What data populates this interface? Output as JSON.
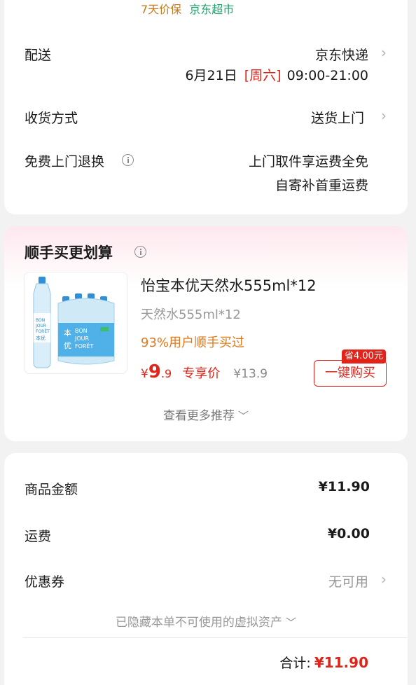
{
  "delivery": {
    "price_protect_label": "7天价保",
    "store_tag": "京东超市",
    "shipping_label": "配送",
    "shipping_carrier": "京东快递",
    "shipping_date": "6月21日",
    "shipping_weekday": "[周六]",
    "shipping_time": "09:00-21:00",
    "receive_method_label": "收货方式",
    "receive_method_value": "送货上门",
    "free_return_label": "免费上门退换",
    "free_return_line1": "上门取件享运费全免",
    "free_return_line2": "自寄补首重运费"
  },
  "addon": {
    "title": "顺手买更划算",
    "product": {
      "name": "怡宝本优天然水555ml*12",
      "spec": "天然水555ml*12",
      "bought_ratio": "93%用户顺手买过",
      "price_symbol": "¥",
      "price_int": "9",
      "price_dec": ".9",
      "price_tag": "专享价",
      "original_price": "¥13.9",
      "save_badge": "省4.00元",
      "buy_button": "一键购买",
      "image_brand_text": "BON JOUR FORÊT",
      "image_cn_text": "本优"
    },
    "more_label": "查看更多推荐"
  },
  "summary": {
    "goods_amount_label": "商品金额",
    "goods_amount_value": "¥11.90",
    "freight_label": "运费",
    "freight_value": "¥0.00",
    "coupon_label": "优惠券",
    "coupon_value": "无可用",
    "hidden_assets_note": "已隐藏本单不可使用的虚拟资产",
    "total_label": "合计:",
    "total_value": "¥11.90"
  },
  "colors": {
    "accent_red": "#e2231a",
    "jd_green": "#21a06b",
    "protect_orange": "#c47a1c",
    "bought_orange": "#e07a1c"
  },
  "icons": {
    "info": "info-circle-icon",
    "chevron_right": "chevron-right-icon",
    "chevron_down": "chevron-down-icon"
  }
}
